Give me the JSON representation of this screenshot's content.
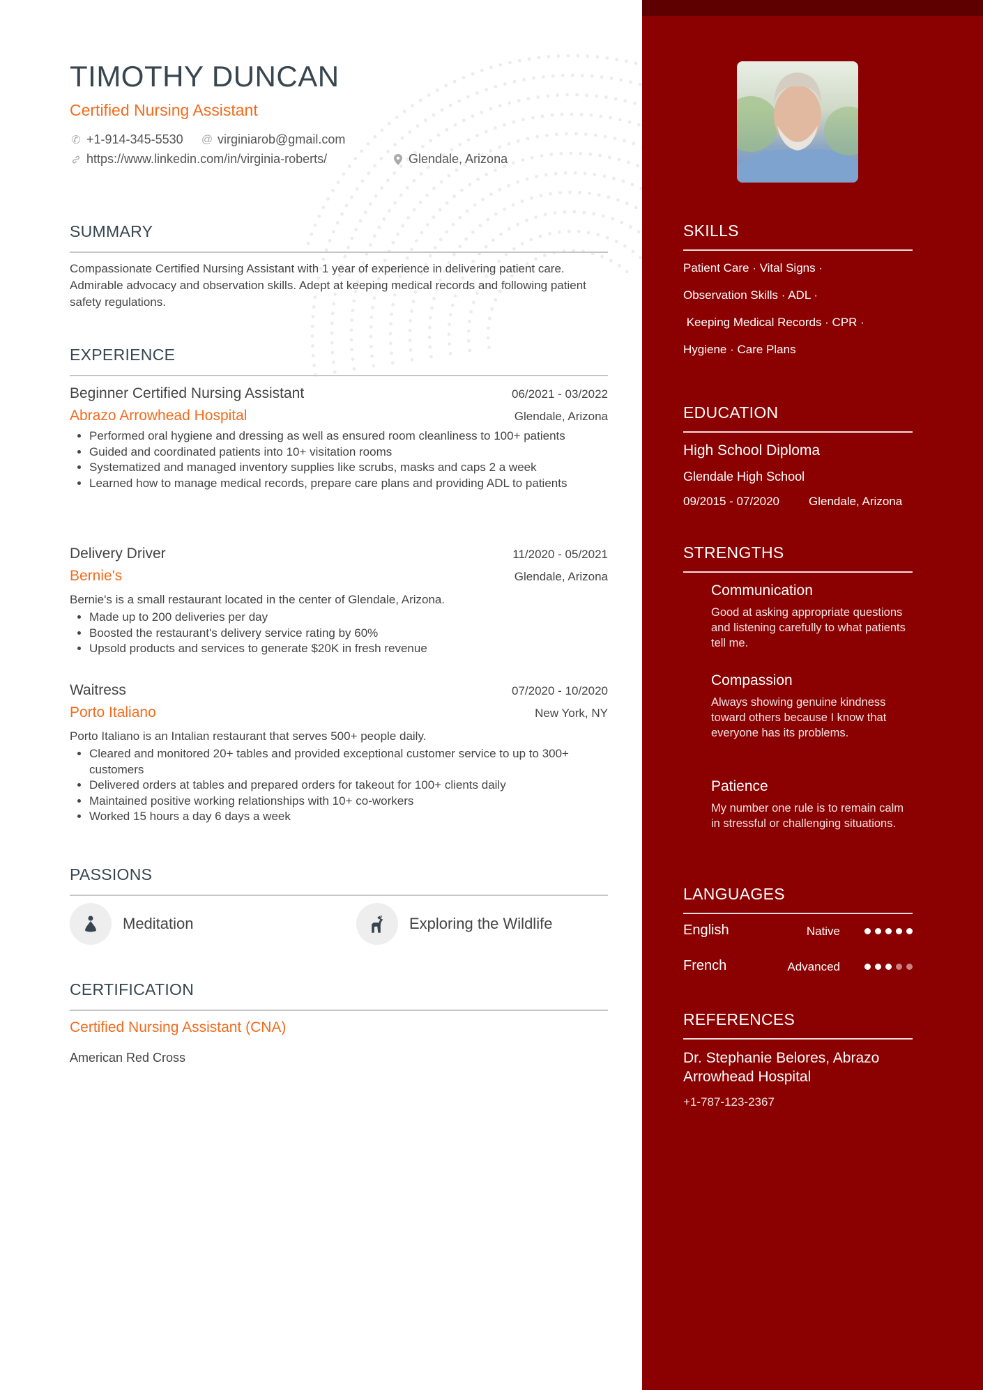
{
  "header": {
    "name": "TIMOTHY DUNCAN",
    "title": "Certified Nursing Assistant",
    "phone": "+1-914-345-5530",
    "email": "virginiarob@gmail.com",
    "linkedin": "https://www.linkedin.com/in/virginia-roberts/",
    "location": "Glendale, Arizona",
    "icons": {
      "phone": "phone-icon",
      "email": "at-icon",
      "link": "link-icon",
      "location": "map-pin-icon"
    }
  },
  "summary": {
    "heading": "SUMMARY",
    "text": "Compassionate Certified Nursing Assistant with 1 year of experience in delivering patient care. Admirable advocacy and observation skills. Adept at keeping medical records and following patient safety regulations."
  },
  "experience": {
    "heading": "EXPERIENCE",
    "items": [
      {
        "role": "Beginner Certified Nursing Assistant",
        "dates": "06/2021 - 03/2022",
        "company": "Abrazo Arrowhead Hospital",
        "location": "Glendale, Arizona",
        "description": "",
        "bullets": [
          "Performed oral hygiene and dressing as well as ensured room cleanliness to 100+ patients",
          "Guided and coordinated patients into 10+ visitation rooms",
          "Systematized and managed inventory supplies like scrubs, masks and caps 2 a week",
          "Learned how to manage medical records, prepare care plans and providing ADL to patients"
        ]
      },
      {
        "role": "Delivery Driver",
        "dates": "11/2020 - 05/2021",
        "company": "Bernie's",
        "location": "Glendale, Arizona",
        "description": "Bernie's is a small restaurant located in the center of Glendale, Arizona.",
        "bullets": [
          "Made up to 200 deliveries per day",
          "Boosted the restaurant's delivery service rating by 60%",
          "Upsold products and services to generate $20K in fresh revenue"
        ]
      },
      {
        "role": "Waitress",
        "dates": "07/2020 - 10/2020",
        "company": "Porto Italiano",
        "location": "New York, NY",
        "description": "Porto Italiano is an Intalian restaurant that serves 500+ people daily.",
        "bullets": [
          "Cleared and monitored 20+ tables and provided exceptional customer service to up to 300+ customers",
          "Delivered orders at tables and prepared orders for takeout for 100+ clients daily",
          "Maintained positive working relationships with 10+ co-workers",
          "Worked 15 hours a day 6 days a week"
        ]
      }
    ]
  },
  "passions": {
    "heading": "PASSIONS",
    "items": [
      {
        "label": "Meditation",
        "icon": "meditation-icon"
      },
      {
        "label": "Exploring the Wildlife",
        "icon": "deer-icon"
      }
    ]
  },
  "certification": {
    "heading": "CERTIFICATION",
    "name": "Certified Nursing Assistant (CNA)",
    "issuer": "American Red Cross"
  },
  "sidebar": {
    "skills": {
      "heading": "SKILLS",
      "lines": [
        "Patient Care · Vital Signs ·",
        "Observation Skills · ADL ·",
        " Keeping Medical Records · CPR ·",
        "Hygiene · Care Plans"
      ]
    },
    "education": {
      "heading": "EDUCATION",
      "degree": "High School Diploma",
      "school": "Glendale High School",
      "dates": "09/2015 - 07/2020",
      "location": "Glendale, Arizona"
    },
    "strengths": {
      "heading": "STRENGTHS",
      "items": [
        {
          "title": "Communication",
          "desc": "Good at asking appropriate questions and listening carefully to what patients tell me."
        },
        {
          "title": "Compassion",
          "desc": "Always showing genuine kindness toward others because I know that everyone has its problems."
        },
        {
          "title": "Patience",
          "desc": "My number one rule is to remain calm in stressful or challenging situations."
        }
      ]
    },
    "languages": {
      "heading": "LANGUAGES",
      "items": [
        {
          "name": "English",
          "level": "Native",
          "rating": 5,
          "max": 5
        },
        {
          "name": "French",
          "level": "Advanced",
          "rating": 3,
          "max": 5
        }
      ]
    },
    "references": {
      "heading": "REFERENCES",
      "name": "Dr. Stephanie Belores, Abrazo Arrowhead Hospital",
      "phone": "+1-787-123-2367"
    }
  },
  "colors": {
    "accent": "#f26b1d",
    "sidebar": "#8b0000",
    "sidebar_top": "#5e0000",
    "text": "#36454f"
  }
}
